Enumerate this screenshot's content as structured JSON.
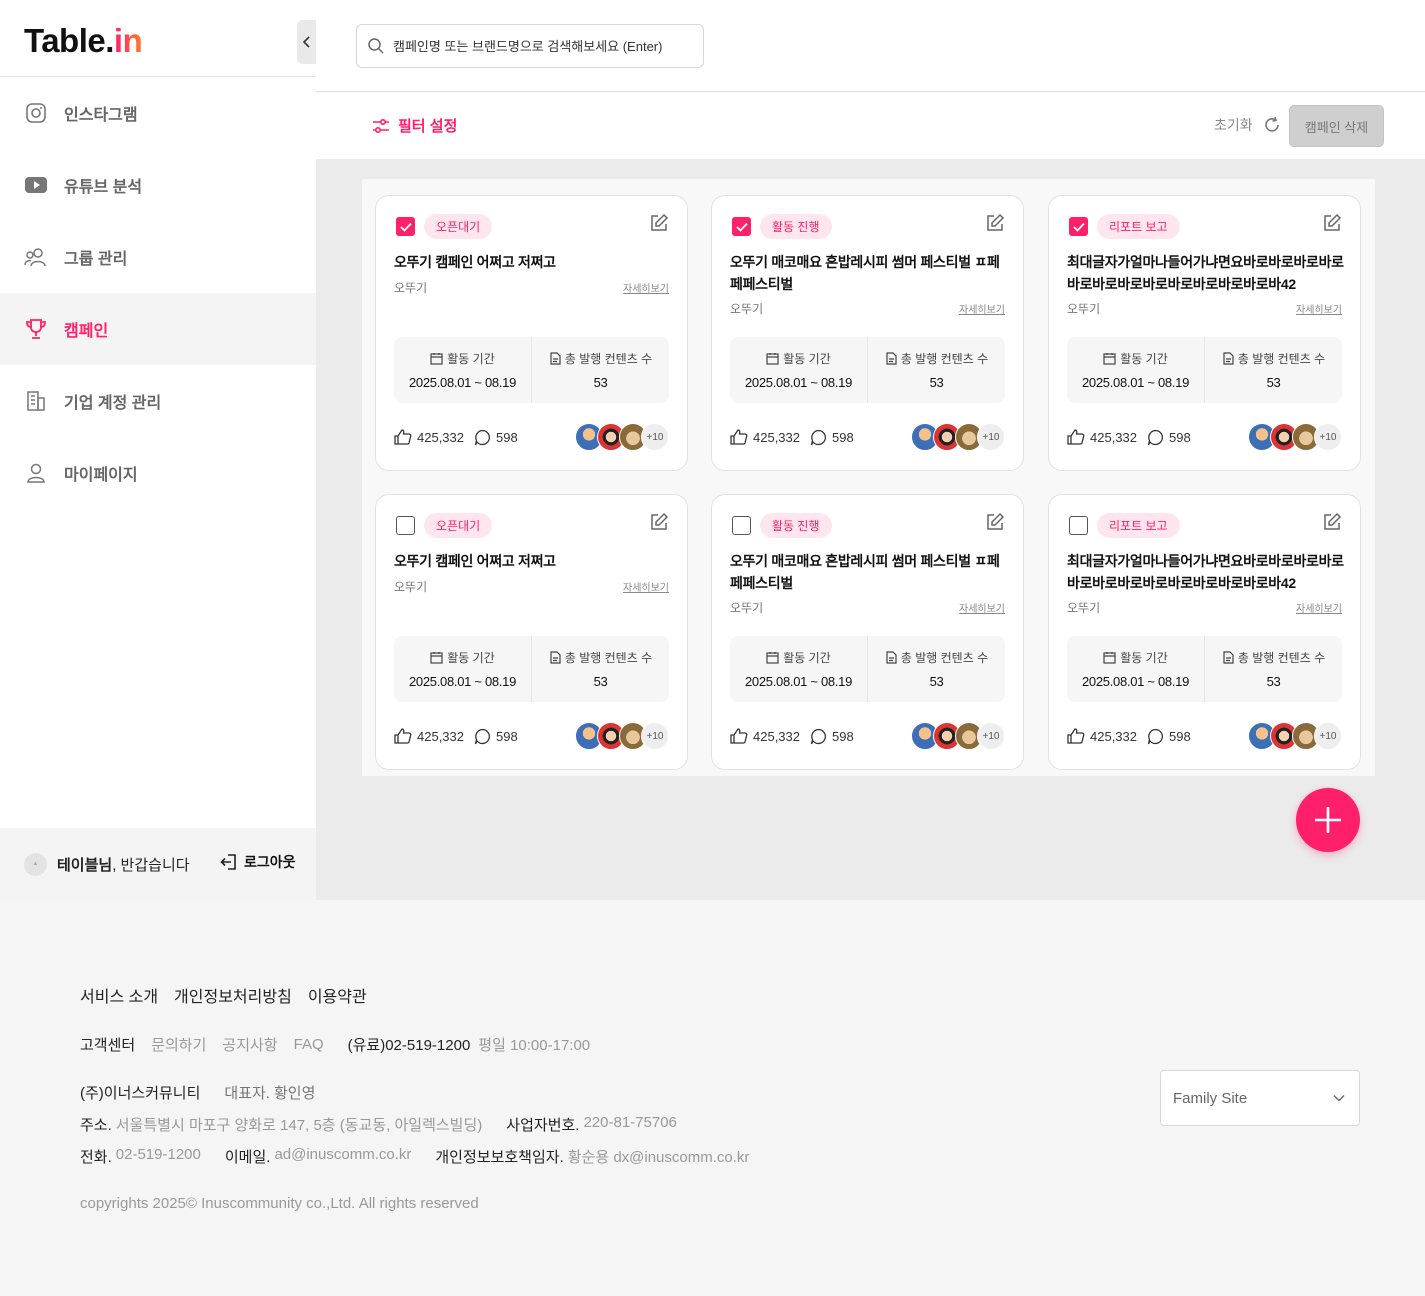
{
  "brand": {
    "logo_main": "Table.",
    "logo_accent": "in"
  },
  "sidebar": {
    "items": [
      {
        "label": "인스타그램",
        "icon": "instagram-icon",
        "active": false
      },
      {
        "label": "유튜브 분석",
        "icon": "youtube-icon",
        "active": false
      },
      {
        "label": "그룹 관리",
        "icon": "users-icon",
        "active": false
      },
      {
        "label": "캠페인",
        "icon": "trophy-icon",
        "active": true
      },
      {
        "label": "기업 계정 관리",
        "icon": "building-icon",
        "active": false
      },
      {
        "label": "마이페이지",
        "icon": "user-icon",
        "active": false
      }
    ],
    "user_name": "테이블님",
    "greeting_suffix": ", 반갑습니다",
    "logout_label": "로그아웃"
  },
  "search": {
    "placeholder": "캠페인명 또는 브랜드명으로 검색해보세요 (Enter)"
  },
  "toolbar": {
    "filter_label": "필터 설정",
    "reset_label": "초기화",
    "delete_label": "캠페인 삭제"
  },
  "card_labels": {
    "detail": "자세히보기",
    "period": "활동 기간",
    "contents": "총 발행 컨텐츠 수"
  },
  "campaigns": [
    {
      "checked": true,
      "status": "오픈대기",
      "title": "오뚜기 캠페인 어쩌고 저쩌고",
      "brand": "오뚜기",
      "period": "2025.08.01 ~ 08.19",
      "contents": "53",
      "likes": "425,332",
      "comments": "598",
      "more": "+10"
    },
    {
      "checked": true,
      "status": "활동 진행",
      "title": "오뚜기 매코매요 혼밥레시피 썸머 페스티벌 ㅍ페페페스티벌",
      "brand": "오뚜기",
      "period": "2025.08.01 ~ 08.19",
      "contents": "53",
      "likes": "425,332",
      "comments": "598",
      "more": "+10"
    },
    {
      "checked": true,
      "status": "리포트 보고",
      "title": "최대글자가얼마나들어가냐면요바로바로바로바로바로바로바로바로바로바로바로바로바42",
      "brand": "오뚜기",
      "period": "2025.08.01 ~ 08.19",
      "contents": "53",
      "likes": "425,332",
      "comments": "598",
      "more": "+10"
    },
    {
      "checked": false,
      "status": "오픈대기",
      "title": "오뚜기 캠페인 어쩌고 저쩌고",
      "brand": "오뚜기",
      "period": "2025.08.01 ~ 08.19",
      "contents": "53",
      "likes": "425,332",
      "comments": "598",
      "more": "+10"
    },
    {
      "checked": false,
      "status": "활동 진행",
      "title": "오뚜기 매코매요 혼밥레시피 썸머 페스티벌 ㅍ페페페스티벌",
      "brand": "오뚜기",
      "period": "2025.08.01 ~ 08.19",
      "contents": "53",
      "likes": "425,332",
      "comments": "598",
      "more": "+10"
    },
    {
      "checked": false,
      "status": "리포트 보고",
      "title": "최대글자가얼마나들어가냐면요바로바로바로바로바로바로바로바로바로바로바로바로바42",
      "brand": "오뚜기",
      "period": "2025.08.01 ~ 08.19",
      "contents": "53",
      "likes": "425,332",
      "comments": "598",
      "more": "+10"
    }
  ],
  "footer": {
    "links": [
      "서비스 소개",
      "개인정보처리방침",
      "이용약관"
    ],
    "cs_label": "고객센터",
    "cs_links": [
      "문의하기",
      "공지사항",
      "FAQ"
    ],
    "phone": "(유료)02-519-1200",
    "hours": "평일 10:00-17:00",
    "company": "(주)이너스커뮤니티",
    "ceo_label": "대표자.",
    "ceo": "황인영",
    "address_label": "주소.",
    "address": "서울특별시 마포구 양화로 147, 5층 (동교동, 아일렉스빌딩)",
    "bizno_label": "사업자번호.",
    "bizno": "220-81-75706",
    "tel_label": "전화.",
    "tel": "02-519-1200",
    "email_label": "이메일.",
    "email": "ad@inuscomm.co.kr",
    "privacy_label": "개인정보보호책임자.",
    "privacy": "황순용 dx@inuscomm.co.kr",
    "copyright": "copyrights 2025© Inuscommunity co.,Ltd. All rights reserved",
    "family_site": "Family Site"
  },
  "colors": {
    "accent": "#ff1f6b",
    "badge_bg": "#ffe6ee"
  }
}
